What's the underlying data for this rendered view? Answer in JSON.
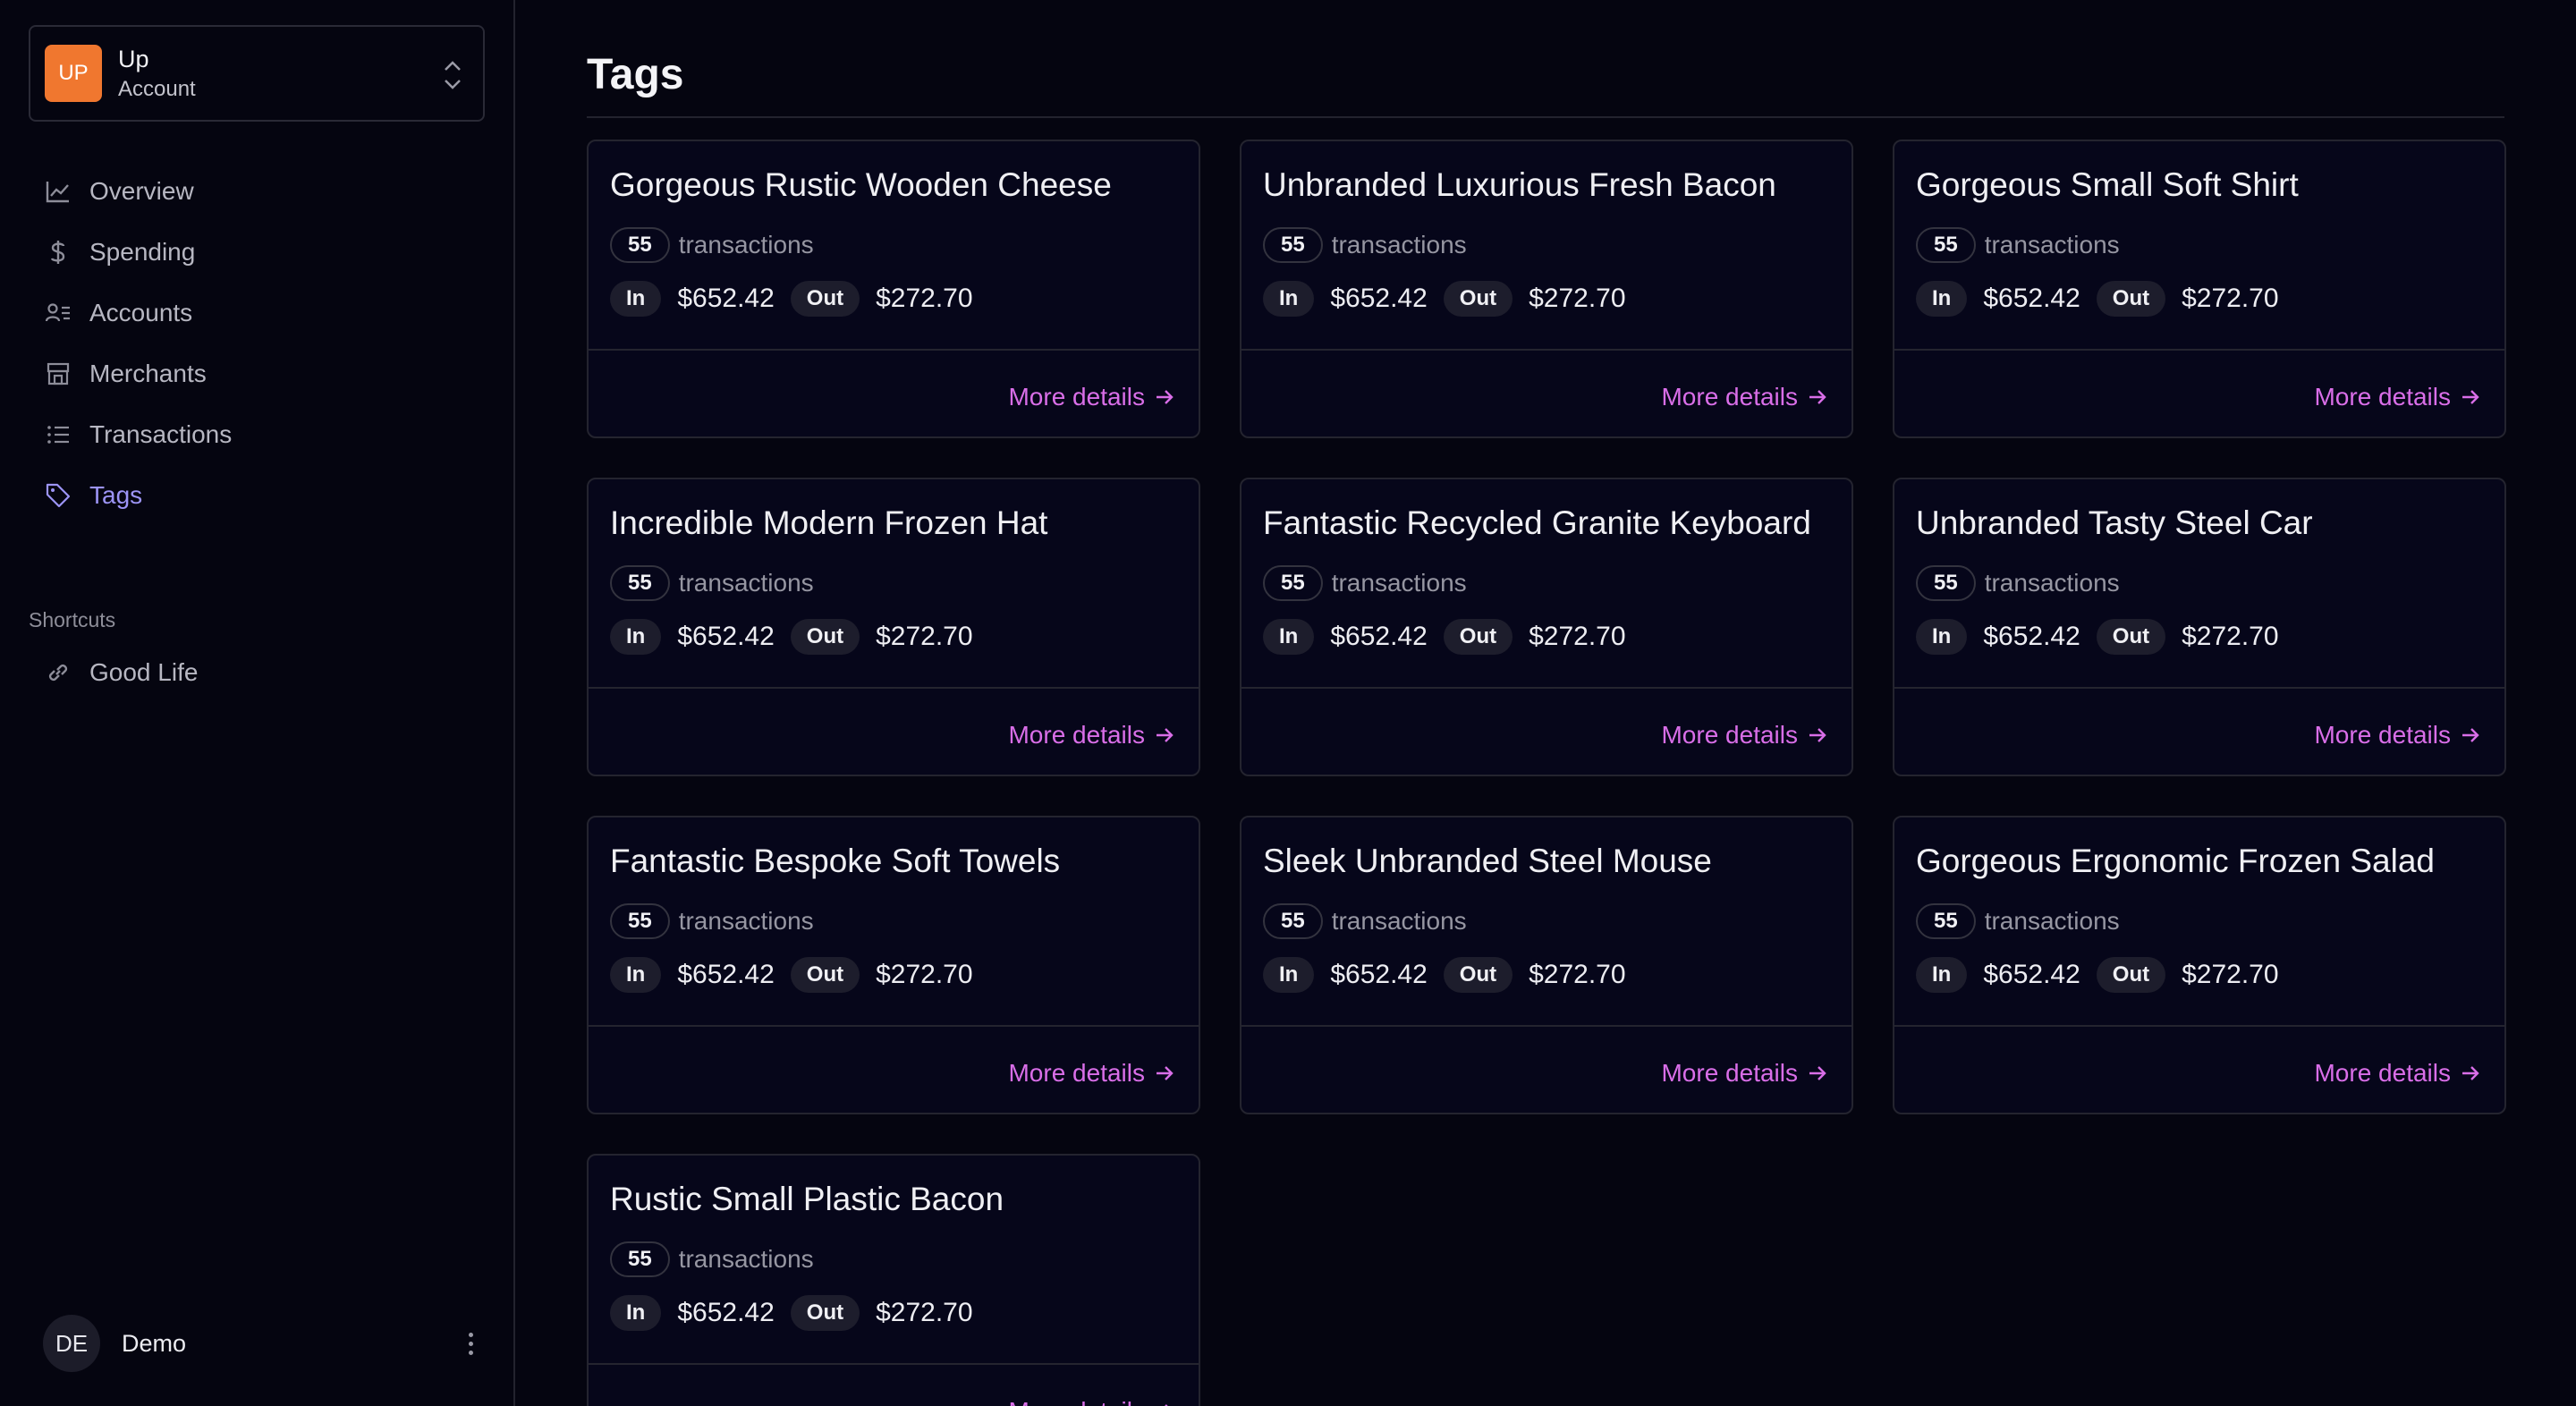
{
  "account": {
    "initials": "UP",
    "name": "Up",
    "type": "Account"
  },
  "nav": [
    {
      "label": "Overview",
      "icon": "chart-line-icon"
    },
    {
      "label": "Spending",
      "icon": "dollar-icon"
    },
    {
      "label": "Accounts",
      "icon": "accounts-icon"
    },
    {
      "label": "Merchants",
      "icon": "store-icon"
    },
    {
      "label": "Transactions",
      "icon": "list-icon"
    },
    {
      "label": "Tags",
      "icon": "tag-icon",
      "active": true
    }
  ],
  "shortcuts": {
    "heading": "Shortcuts",
    "items": [
      {
        "label": "Good Life",
        "icon": "link-icon"
      }
    ]
  },
  "user": {
    "initials": "DE",
    "name": "Demo"
  },
  "page": {
    "title": "Tags"
  },
  "labels": {
    "transactions": "transactions",
    "in": "In",
    "out": "Out",
    "more": "More details"
  },
  "tags": [
    {
      "name": "Gorgeous Rustic Wooden Cheese",
      "count": "55",
      "in": "$652.42",
      "out": "$272.70"
    },
    {
      "name": "Unbranded Luxurious Fresh Bacon",
      "count": "55",
      "in": "$652.42",
      "out": "$272.70"
    },
    {
      "name": "Gorgeous Small Soft Shirt",
      "count": "55",
      "in": "$652.42",
      "out": "$272.70"
    },
    {
      "name": "Incredible Modern Frozen Hat",
      "count": "55",
      "in": "$652.42",
      "out": "$272.70"
    },
    {
      "name": "Fantastic Recycled Granite Keyboard",
      "count": "55",
      "in": "$652.42",
      "out": "$272.70"
    },
    {
      "name": "Unbranded Tasty Steel Car",
      "count": "55",
      "in": "$652.42",
      "out": "$272.70"
    },
    {
      "name": "Fantastic Bespoke Soft Towels",
      "count": "55",
      "in": "$652.42",
      "out": "$272.70"
    },
    {
      "name": "Sleek Unbranded Steel Mouse",
      "count": "55",
      "in": "$652.42",
      "out": "$272.70"
    },
    {
      "name": "Gorgeous Ergonomic Frozen Salad",
      "count": "55",
      "in": "$652.42",
      "out": "$272.70"
    },
    {
      "name": "Rustic Small Plastic Bacon",
      "count": "55",
      "in": "$652.42",
      "out": "$272.70"
    }
  ],
  "colors": {
    "accent": "#9c94f5",
    "link": "#d96ee8",
    "avatar": "#f0772f",
    "background": "#050510"
  }
}
